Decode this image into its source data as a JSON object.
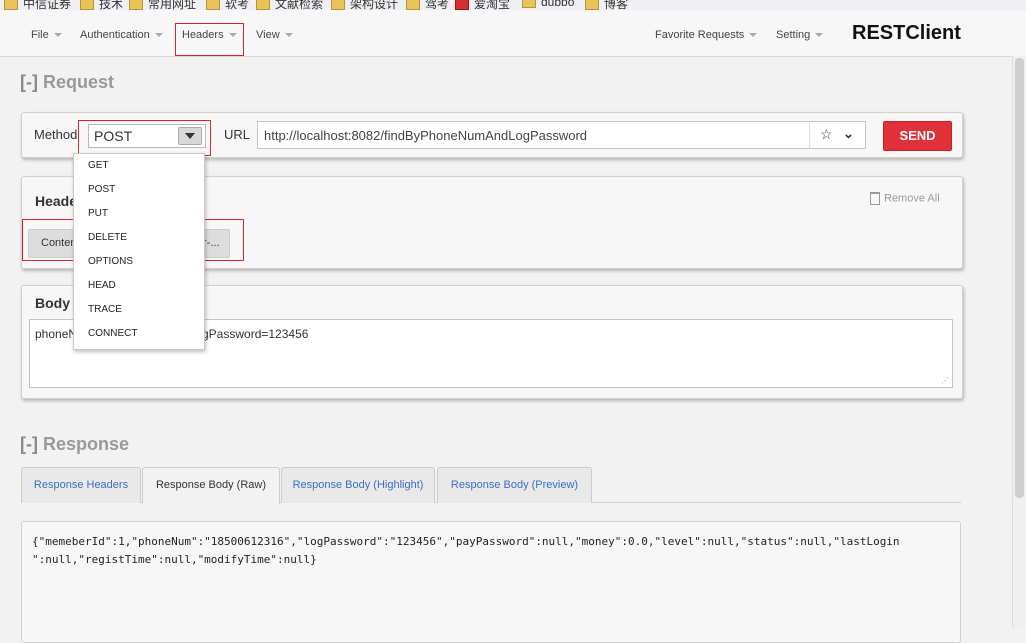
{
  "bookmarks": [
    {
      "label": "中信证券"
    },
    {
      "label": "技术"
    },
    {
      "label": "常用网址"
    },
    {
      "label": "软考"
    },
    {
      "label": "文献检索"
    },
    {
      "label": "架构设计"
    },
    {
      "label": "驾考"
    },
    {
      "label": "爱淘宝"
    },
    {
      "label": "dubbo"
    },
    {
      "label": "博客"
    }
  ],
  "navbar": {
    "menus": [
      {
        "label": "File"
      },
      {
        "label": "Authentication"
      },
      {
        "label": "Headers"
      },
      {
        "label": "View"
      },
      {
        "label": "Favorite Requests"
      },
      {
        "label": "Setting"
      }
    ],
    "brand": "RESTClient"
  },
  "request": {
    "section_bracket": "[-]",
    "section_title": "Request",
    "method_label": "Method",
    "method_value": "POST",
    "url_label": "URL",
    "url_value": "http://localhost:8082/findByPhoneNumAndLogPassword",
    "send_label": "SEND",
    "method_options": [
      "GET",
      "POST",
      "PUT",
      "DELETE",
      "OPTIONS",
      "HEAD",
      "TRACE",
      "CONNECT"
    ]
  },
  "headers_panel": {
    "title": "Heade",
    "remove_all": "Remove All",
    "chip_left": "Conten",
    "chip_right": "r-..."
  },
  "body_panel": {
    "title": "Body",
    "text_left": "phoneN",
    "text_right": "gPassword=123456"
  },
  "response": {
    "section_bracket": "[-]",
    "section_title": "Response",
    "tabs": [
      {
        "label": "Response Headers"
      },
      {
        "label": "Response Body (Raw)"
      },
      {
        "label": "Response Body (Highlight)"
      },
      {
        "label": "Response Body (Preview)"
      }
    ],
    "active_tab": "Response Body (Raw)",
    "body_line1": "{\"memeberId\":1,\"phoneNum\":\"18500612316\",\"logPassword\":\"123456\",\"payPassword\":null,\"money\":0.0,\"level\":null,\"status\":null,\"lastLogin",
    "body_line2": "\":null,\"registTime\":null,\"modifyTime\":null}"
  },
  "colors": {
    "send": "#e0313a",
    "highlight_box": "#d9242a",
    "tab_link": "#3a6fc4"
  }
}
